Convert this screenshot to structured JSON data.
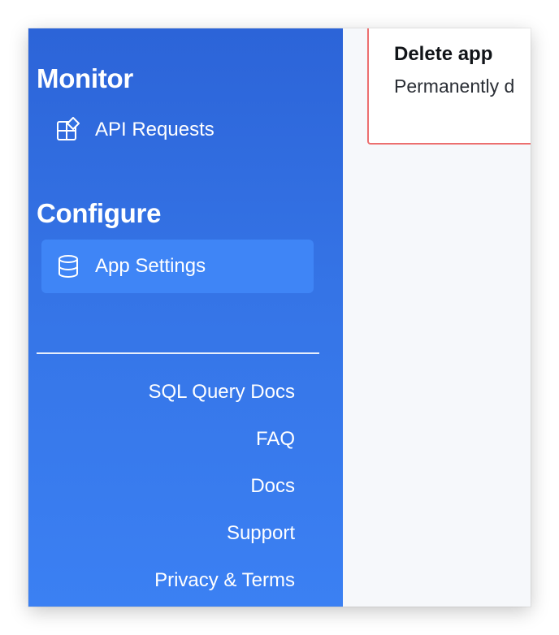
{
  "sidebar": {
    "monitor_title": "Monitor",
    "api_requests_label": "API Requests",
    "configure_title": "Configure",
    "app_settings_label": "App Settings",
    "footer_links": [
      "SQL Query Docs",
      "FAQ",
      "Docs",
      "Support",
      "Privacy & Terms"
    ]
  },
  "main": {
    "delete_card": {
      "title": "Delete app",
      "description": "Permanently d"
    }
  },
  "colors": {
    "sidebar_top": "#2c64d8",
    "sidebar_bottom": "#3b80f3",
    "active_item": "#3f85f6",
    "danger_border": "#ec6f6f",
    "main_bg": "#f6f8fb"
  },
  "icons": {
    "api_requests": "api-requests-icon",
    "app_settings": "database-icon"
  }
}
